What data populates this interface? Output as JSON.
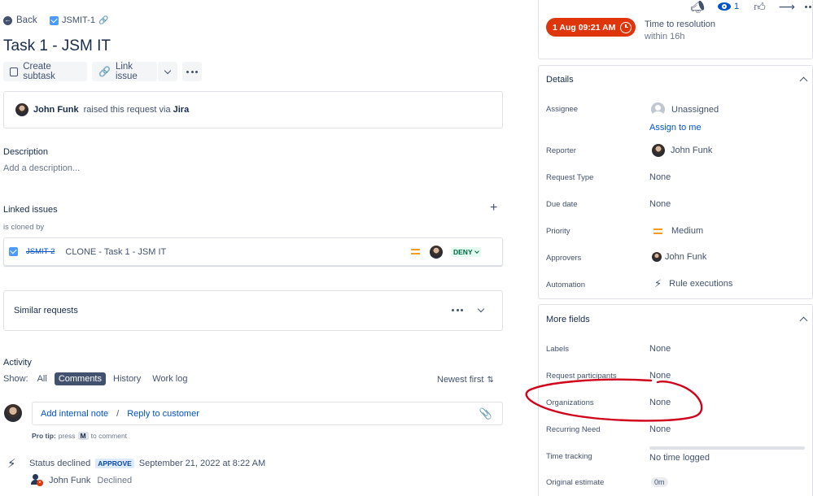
{
  "nav": {
    "back_label": "Back",
    "issue_key": "JSMIT-1"
  },
  "issue": {
    "title": "Task 1 - JSM IT"
  },
  "toolbar": {
    "create_subtask": "Create subtask",
    "link_issue": "Link issue"
  },
  "raised": {
    "user": "John Funk",
    "text": "raised this request via",
    "channel": "Jira"
  },
  "description": {
    "heading": "Description",
    "placeholder": "Add a description..."
  },
  "linked": {
    "heading": "Linked issues",
    "relation": "is cloned by",
    "item": {
      "key": "JSMIT-2",
      "summary": "CLONE - Task 1 - JSM IT",
      "status": "DENY"
    }
  },
  "similar": {
    "heading": "Similar requests"
  },
  "activity": {
    "heading": "Activity",
    "show_label": "Show:",
    "tabs": [
      "All",
      "Comments",
      "History",
      "Work log"
    ],
    "active_tab": "Comments",
    "sort": "Newest first",
    "add_note": "Add internal note",
    "separator": "/",
    "reply": "Reply to customer",
    "pro_tip_prefix": "Pro tip:",
    "pro_tip_press": "press",
    "pro_tip_key": "M",
    "pro_tip_suffix": "to comment",
    "event": {
      "text": "Status declined",
      "badge": "APPROVE",
      "date": "September 21, 2022 at 8:22 AM",
      "user": "John Funk",
      "action": "Declined"
    }
  },
  "topbar": {
    "watch_count": "1"
  },
  "sla": {
    "badge": "1 Aug 09:21 AM",
    "title": "Time to resolution",
    "sub": "within 16h"
  },
  "details": {
    "heading": "Details",
    "assignee_label": "Assignee",
    "assignee_value": "Unassigned",
    "assign_to_me": "Assign to me",
    "reporter_label": "Reporter",
    "reporter_value": "John Funk",
    "request_type_label": "Request Type",
    "request_type_value": "None",
    "due_label": "Due date",
    "due_value": "None",
    "priority_label": "Priority",
    "priority_value": "Medium",
    "approvers_label": "Approvers",
    "approvers_value": "John Funk",
    "automation_label": "Automation",
    "automation_value": "Rule executions"
  },
  "more_fields": {
    "heading": "More fields",
    "labels_label": "Labels",
    "labels_value": "None",
    "participants_label": "Request participants",
    "participants_value": "None",
    "orgs_label": "Organizations",
    "orgs_value": "None",
    "recurring_label": "Recurring Need",
    "recurring_value": "None",
    "tracking_label": "Time tracking",
    "tracking_value": "No time logged",
    "estimate_label": "Original estimate",
    "estimate_value": "0m"
  },
  "colors": {
    "sla_red": "#de350b",
    "annotation_red": "#d0021b",
    "link_blue": "#0052cc",
    "deny_green": "#006644"
  }
}
